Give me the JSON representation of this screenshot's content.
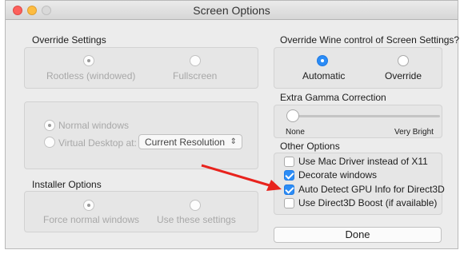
{
  "window": {
    "title": "Screen Options"
  },
  "override_settings": {
    "label": "Override Settings",
    "rootless_label": "Rootless (windowed)",
    "fullscreen_label": "Fullscreen",
    "selected": "Rootless (windowed)"
  },
  "window_mode": {
    "normal_label": "Normal windows",
    "virtual_desktop_label": "Virtual Desktop at:",
    "resolution_value": "Current Resolution",
    "selected": "Normal windows"
  },
  "installer_options": {
    "label": "Installer Options",
    "force_normal_label": "Force normal windows",
    "use_these_label": "Use these settings",
    "selected": "Force normal windows"
  },
  "wine_control": {
    "label": "Override Wine control of Screen Settings?",
    "automatic_label": "Automatic",
    "override_label": "Override",
    "selected": "Automatic"
  },
  "gamma": {
    "label": "Extra Gamma Correction",
    "min_label": "None",
    "max_label": "Very Bright",
    "value_fraction": 0.0
  },
  "other_options": {
    "label": "Other Options",
    "items": [
      {
        "label": "Use Mac Driver instead of X11",
        "checked": false
      },
      {
        "label": "Decorate windows",
        "checked": true
      },
      {
        "label": "Auto Detect GPU Info for Direct3D",
        "checked": true
      },
      {
        "label": "Use Direct3D Boost (if available)",
        "checked": false
      }
    ]
  },
  "done_button": {
    "label": "Done"
  },
  "colors": {
    "accent": "#2b8cf6",
    "arrow": "#e8231d"
  }
}
